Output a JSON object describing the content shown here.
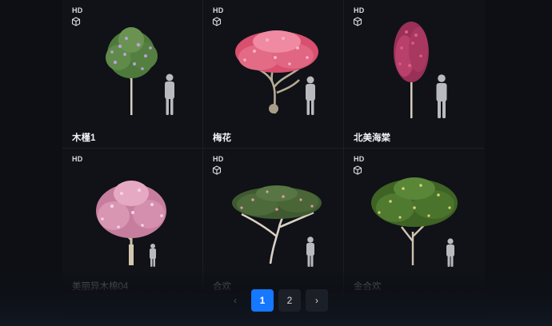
{
  "cards": [
    {
      "badge": "HD",
      "title": "木槿1",
      "icon": "cube-icon",
      "colors": {
        "foliage": "#5f8a4a",
        "bloom": "#b7a1d8"
      }
    },
    {
      "badge": "HD",
      "title": "梅花",
      "icon": "cube-icon",
      "colors": {
        "foliage": "#e36b86",
        "bloom": "#f08aa0"
      }
    },
    {
      "badge": "HD",
      "title": "北美海棠",
      "icon": "cube-icon",
      "colors": {
        "foliage": "#b8406a",
        "bloom": "#d9608a"
      }
    },
    {
      "badge": "HD",
      "title": "美丽异木棉04",
      "icon": "cube-icon",
      "colors": {
        "foliage": "#e6a9c3",
        "bloom": "#f2c4d6"
      }
    },
    {
      "badge": "HD",
      "title": "合欢",
      "icon": "cube-icon",
      "colors": {
        "foliage": "#4d6a3a",
        "bloom": "#d89aa0"
      }
    },
    {
      "badge": "HD",
      "title": "金合欢",
      "icon": "cube-icon",
      "colors": {
        "foliage": "#4f7a30",
        "bloom": "#d8d070"
      }
    }
  ],
  "pagination": {
    "prev_icon": "chevron-left-icon",
    "pages": [
      "1",
      "2"
    ],
    "current": "1",
    "next_icon": "chevron-right-icon",
    "prev_glyph": "‹",
    "next_glyph": "›"
  },
  "colors": {
    "accent": "#1677ff",
    "background": "#0b0d11",
    "card": "#101217"
  }
}
